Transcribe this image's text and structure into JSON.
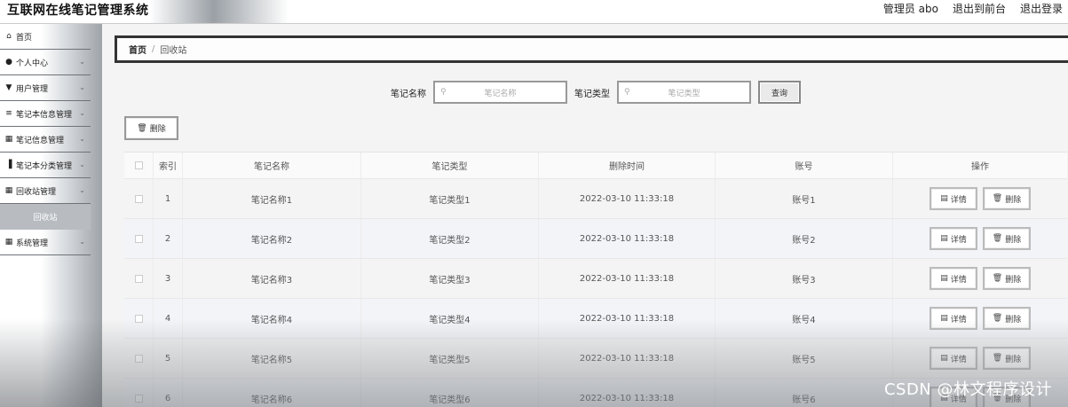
{
  "header": {
    "title": "互联网在线笔记管理系统",
    "admin": "管理员 abo",
    "to_front": "退出到前台",
    "logout": "退出登录"
  },
  "sidebar": {
    "items": [
      {
        "label": "首页",
        "icon": "home-icon"
      },
      {
        "label": "个人中心",
        "icon": "user-icon"
      },
      {
        "label": "用户管理",
        "icon": "users-icon"
      },
      {
        "label": "笔记本信息管理",
        "icon": "sliders-icon"
      },
      {
        "label": "笔记信息管理",
        "icon": "grid-icon"
      },
      {
        "label": "笔记本分类管理",
        "icon": "bar-chart-icon"
      },
      {
        "label": "回收站管理",
        "icon": "grid-icon"
      },
      {
        "label": "系统管理",
        "icon": "grid-icon"
      }
    ],
    "sub_item": "回收站"
  },
  "breadcrumb": {
    "home": "首页",
    "separator": "/",
    "current": "回收站"
  },
  "search": {
    "name_label": "笔记名称",
    "name_placeholder": "笔记名称",
    "type_label": "笔记类型",
    "type_placeholder": "笔记类型",
    "query_button": "查询"
  },
  "toolbar": {
    "delete_label": "删除"
  },
  "table": {
    "headers": [
      "索引",
      "笔记名称",
      "笔记类型",
      "删除时间",
      "账号",
      "操作"
    ],
    "detail_label": "详情",
    "delete_label": "删除",
    "rows": [
      {
        "index": "1",
        "name": "笔记名称1",
        "type": "笔记类型1",
        "time": "2022-03-10 11:33:18",
        "account": "账号1"
      },
      {
        "index": "2",
        "name": "笔记名称2",
        "type": "笔记类型2",
        "time": "2022-03-10 11:33:18",
        "account": "账号2"
      },
      {
        "index": "3",
        "name": "笔记名称3",
        "type": "笔记类型3",
        "time": "2022-03-10 11:33:18",
        "account": "账号3"
      },
      {
        "index": "4",
        "name": "笔记名称4",
        "type": "笔记类型4",
        "time": "2022-03-10 11:33:18",
        "account": "账号4"
      },
      {
        "index": "5",
        "name": "笔记名称5",
        "type": "笔记类型5",
        "time": "2022-03-10 11:33:18",
        "account": "账号5"
      },
      {
        "index": "6",
        "name": "笔记名称6",
        "type": "笔记类型6",
        "time": "2022-03-10 11:33:18",
        "account": "账号6"
      }
    ]
  },
  "watermark": "CSDN @林文程序设计"
}
